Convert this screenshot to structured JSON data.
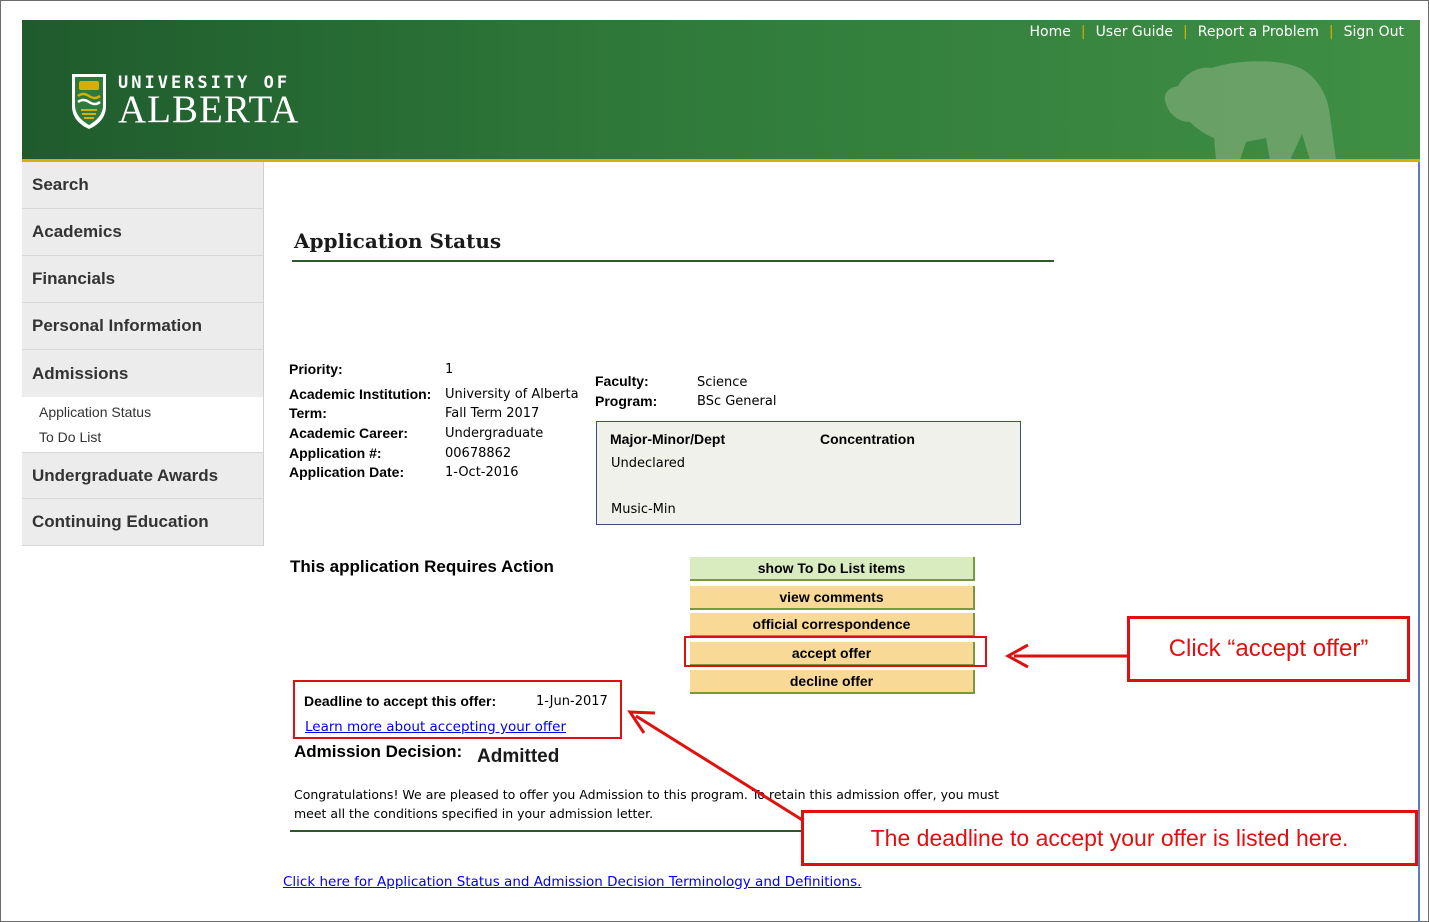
{
  "brand": {
    "line1": "UNIVERSITY OF",
    "line2": "ALBERTA",
    "green": "#1f5b2d",
    "gold": "#d6b000"
  },
  "top_links": {
    "home": "Home",
    "user_guide": "User Guide",
    "report": "Report a Problem",
    "sign_out": "Sign Out",
    "separator": "|"
  },
  "sidebar": {
    "items": {
      "search": "Search",
      "academics": "Academics",
      "financials": "Financials",
      "personal": "Personal Information",
      "admissions": "Admissions",
      "undergrad_awards": "Undergraduate Awards",
      "continuing_ed": "Continuing Education"
    },
    "admissions_sub": {
      "app_status": "Application Status",
      "todo": "To Do List"
    }
  },
  "page": {
    "title": "Application Status"
  },
  "application": {
    "priority_label": "Priority:",
    "priority": "1",
    "institution_label": "Academic Institution:",
    "institution": "University of Alberta",
    "term_label": "Term:",
    "term": "Fall Term 2017",
    "career_label": "Academic Career:",
    "career": "Undergraduate",
    "number_label": "Application #:",
    "number": "00678862",
    "date_label": "Application Date:",
    "date": "1-Oct-2016",
    "faculty_label": "Faculty:",
    "faculty": "Science",
    "program_label": "Program:",
    "program": "BSc General",
    "major_header": "Major-Minor/Dept",
    "concentration_header": "Concentration",
    "major1": "Undeclared",
    "major2": "Music-Min"
  },
  "actions": {
    "requires": "This application Requires Action",
    "todo_btn": "show To Do List items",
    "comments_btn": "view comments",
    "correspondence_btn": "official correspondence",
    "accept_btn": "accept offer",
    "decline_btn": "decline offer"
  },
  "deadline": {
    "label": "Deadline to accept this offer:",
    "date": "1-Jun-2017",
    "learn_link": "Learn more about accepting your offer"
  },
  "decision": {
    "label": "Admission Decision:",
    "value": "Admitted",
    "message_line1": "Congratulations!  We are pleased to offer you Admission to this program.  To retain this admission offer, you must",
    "message_line2": "meet all the conditions specified in your admission letter."
  },
  "terminology_link": "Click here for Application Status and Admission Decision Terminology and Definitions.",
  "callouts": {
    "accept": "Click “accept offer”",
    "deadline": "The deadline to accept your offer is listed here."
  },
  "icons": {
    "crest": "university-crest-icon",
    "bear": "bear-silhouette-icon"
  }
}
